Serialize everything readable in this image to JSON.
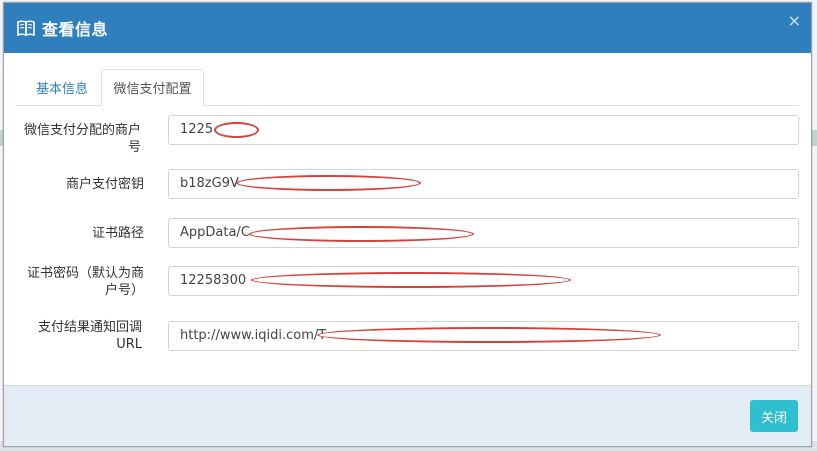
{
  "modal": {
    "title": "查看信息",
    "close_symbol": "×",
    "icon": "book-icon"
  },
  "tabs": [
    {
      "label": "基本信息",
      "active": false
    },
    {
      "label": "微信支付配置",
      "active": true
    }
  ],
  "fields": [
    {
      "label": "微信支付分配的商户号",
      "value": "1225"
    },
    {
      "label": "商户支付密钥",
      "value": "b18zG9V"
    },
    {
      "label": "证书路径",
      "value": "AppData/C"
    },
    {
      "label": "证书密码（默认为商户号）",
      "value": "12258300"
    },
    {
      "label": "支付结果通知回调URL",
      "value": "http://www.iqidi.com/T"
    }
  ],
  "footer": {
    "close_label": "关闭"
  },
  "colors": {
    "header": "#2f7fbf",
    "close_button": "#2fc0cf",
    "footer": "#e3ebf5",
    "redaction": "#d9403a"
  }
}
